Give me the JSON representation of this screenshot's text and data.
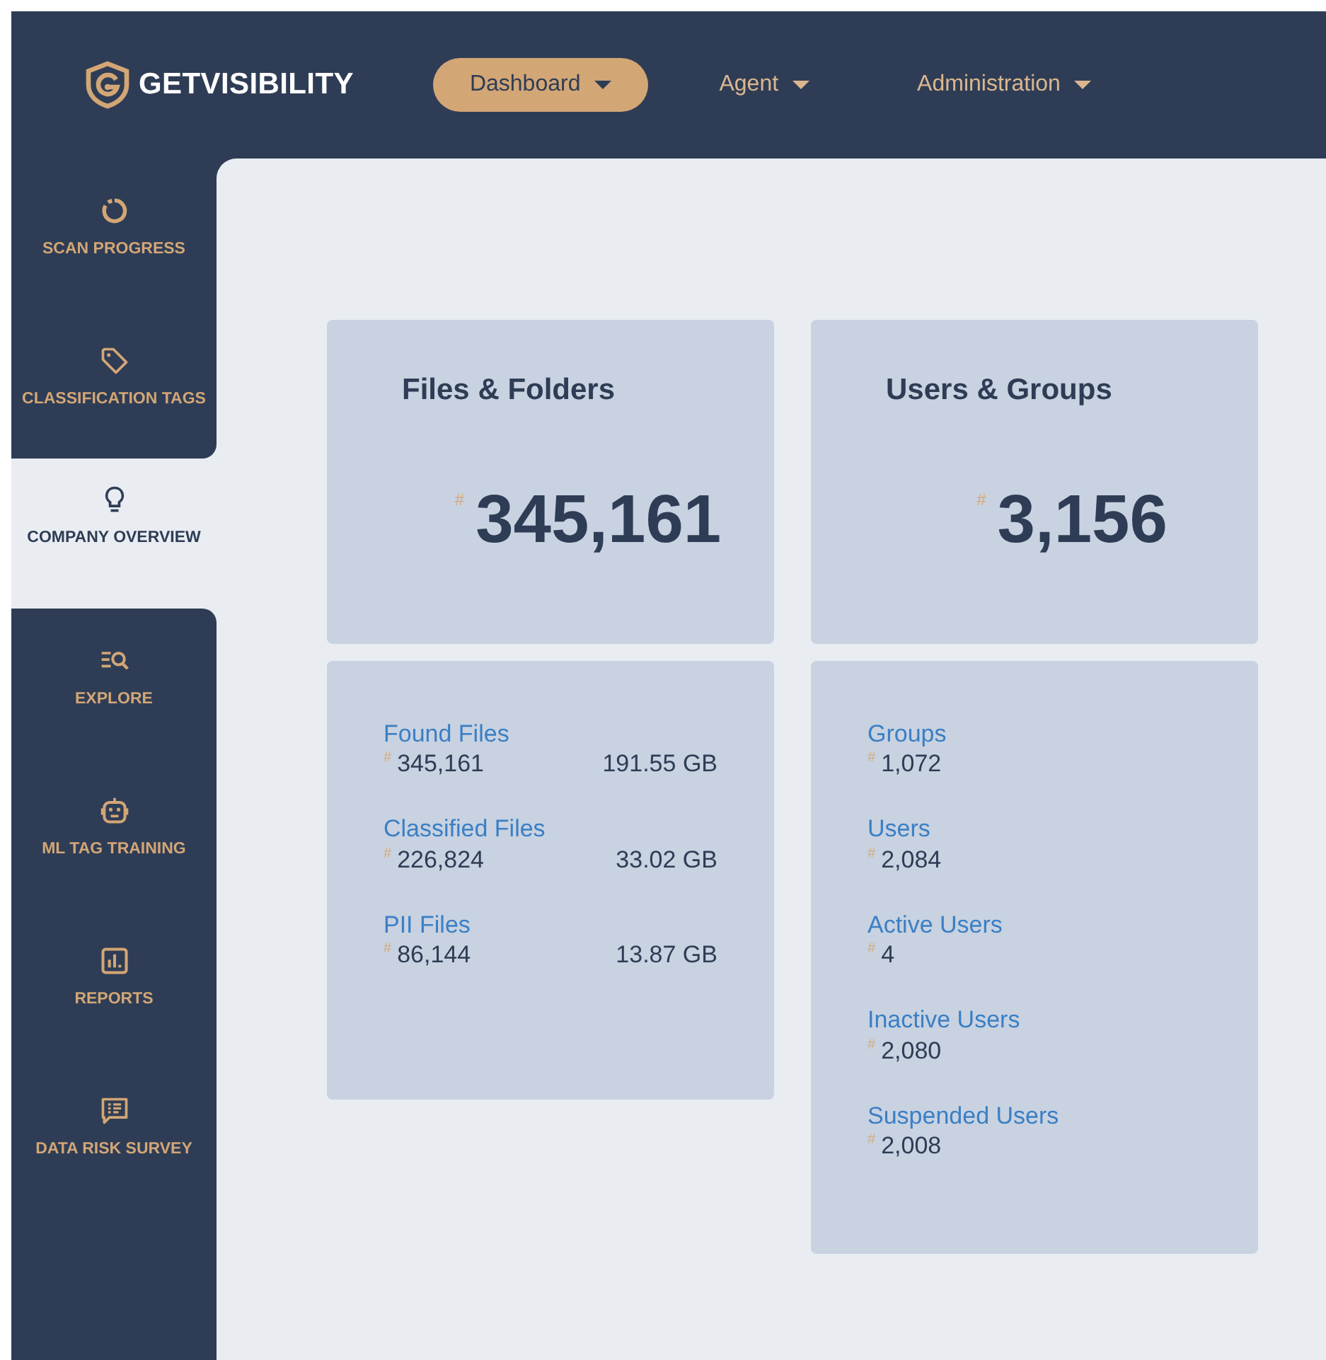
{
  "brand": {
    "name": "GETVISIBILITY"
  },
  "nav": [
    {
      "label": "Dashboard",
      "selected": true
    },
    {
      "label": "Agent",
      "selected": false
    },
    {
      "label": "Administration",
      "selected": false
    }
  ],
  "sidebar": {
    "items": [
      {
        "kind": "progress",
        "label": "SCAN PROGRESS",
        "selected": false
      },
      {
        "kind": "tag",
        "label": "CLASSIFICATION TAGS",
        "selected": false
      },
      {
        "kind": "bulb",
        "label": "COMPANY OVERVIEW",
        "selected": true
      },
      {
        "kind": "explore",
        "label": "EXPLORE",
        "selected": false
      },
      {
        "kind": "robot",
        "label": "ML TAG TRAINING",
        "selected": false
      },
      {
        "kind": "report",
        "label": "REPORTS",
        "selected": false
      },
      {
        "kind": "survey",
        "label": "DATA RISK SURVEY",
        "selected": false
      }
    ]
  },
  "cards": [
    {
      "title": "Files & Folders",
      "hash": "#",
      "total": "345,161",
      "stats": [
        {
          "label": "Found Files",
          "hash": "#",
          "count": "345,161",
          "size": "191.55 GB"
        },
        {
          "label": "Classified Files",
          "hash": "#",
          "count": "226,824",
          "size": "33.02 GB"
        },
        {
          "label": "PII Files",
          "hash": "#",
          "count": "86,144",
          "size": "13.87 GB"
        }
      ]
    },
    {
      "title": "Users & Groups",
      "hash": "#",
      "total": "3,156",
      "stats": [
        {
          "label": "Groups",
          "hash": "#",
          "count": "1,072"
        },
        {
          "label": "Users",
          "hash": "#",
          "count": "2,084"
        },
        {
          "label": "Active Users",
          "hash": "#",
          "count": "4"
        },
        {
          "label": "Inactive Users",
          "hash": "#",
          "count": "2,080"
        },
        {
          "label": "Suspended Users",
          "hash": "#",
          "count": "2,008"
        }
      ]
    }
  ]
}
